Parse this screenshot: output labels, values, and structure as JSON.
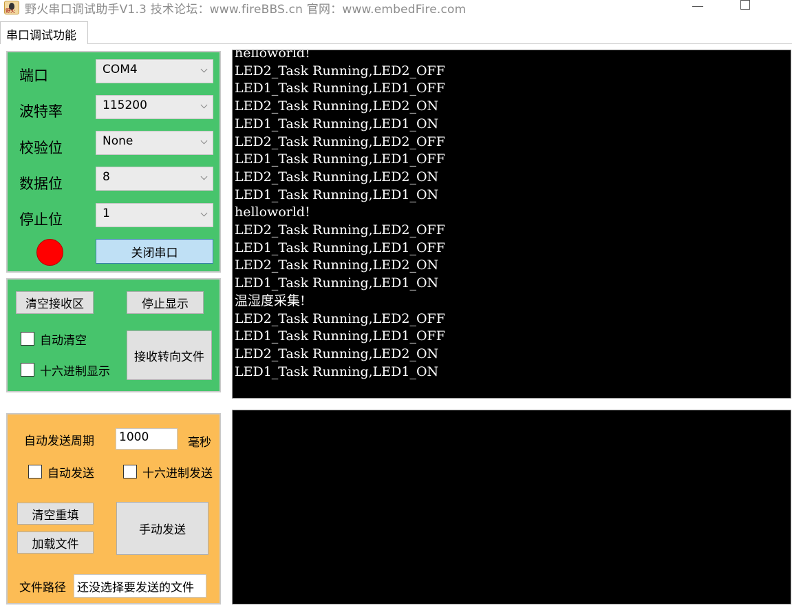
{
  "window": {
    "title": "野火串口调试助手V1.3    技术论坛：www.fireBBS.cn   官网：www.embedFire.com",
    "icon_label": "野火",
    "icon": "flame-logo-icon"
  },
  "tabs": [
    {
      "label": "串口调试功能"
    }
  ],
  "port_settings": {
    "port_label": "端口",
    "port_value": "COM4",
    "baud_label": "波特率",
    "baud_value": "115200",
    "parity_label": "校验位",
    "parity_value": "None",
    "databits_label": "数据位",
    "databits_value": "8",
    "stopbits_label": "停止位",
    "stopbits_value": "1",
    "status_color": "#ff0000",
    "toggle_label": "关闭串口"
  },
  "receive_options": {
    "clear_label": "清空接收区",
    "stop_display_label": "停止显示",
    "auto_clear_label": "自动清空",
    "hex_display_label": "十六进制显示",
    "redirect_file_label": "接收转向文件"
  },
  "send_options": {
    "period_label": "自动发送周期",
    "period_value": "1000",
    "period_unit": "毫秒",
    "auto_send_label": "自动发送",
    "hex_send_label": "十六进制发送",
    "clear_refill_label": "清空重填",
    "load_file_label": "加载文件",
    "manual_send_label": "手动发送",
    "file_path_label": "文件路径",
    "file_path_value": "还没选择要发送的文件"
  },
  "receive_console": {
    "lines": [
      "helloworld!",
      "LED2_Task Running,LED2_OFF",
      "LED1_Task Running,LED1_OFF",
      "LED2_Task Running,LED2_ON",
      "LED1_Task Running,LED1_ON",
      "LED2_Task Running,LED2_OFF",
      "LED1_Task Running,LED1_OFF",
      "LED2_Task Running,LED2_ON",
      "LED1_Task Running,LED1_ON",
      "helloworld!",
      "LED2_Task Running,LED2_OFF",
      "LED1_Task Running,LED1_OFF",
      "LED2_Task Running,LED2_ON",
      "LED1_Task Running,LED1_ON",
      "温湿度采集!",
      "LED2_Task Running,LED2_OFF",
      "LED1_Task Running,LED1_OFF",
      "LED2_Task Running,LED2_ON",
      "LED1_Task Running,LED1_ON"
    ]
  },
  "colors": {
    "port_panel": "#47c46c",
    "send_panel": "#fcbc55",
    "console_bg": "#000000",
    "console_text": "#ffffff"
  }
}
